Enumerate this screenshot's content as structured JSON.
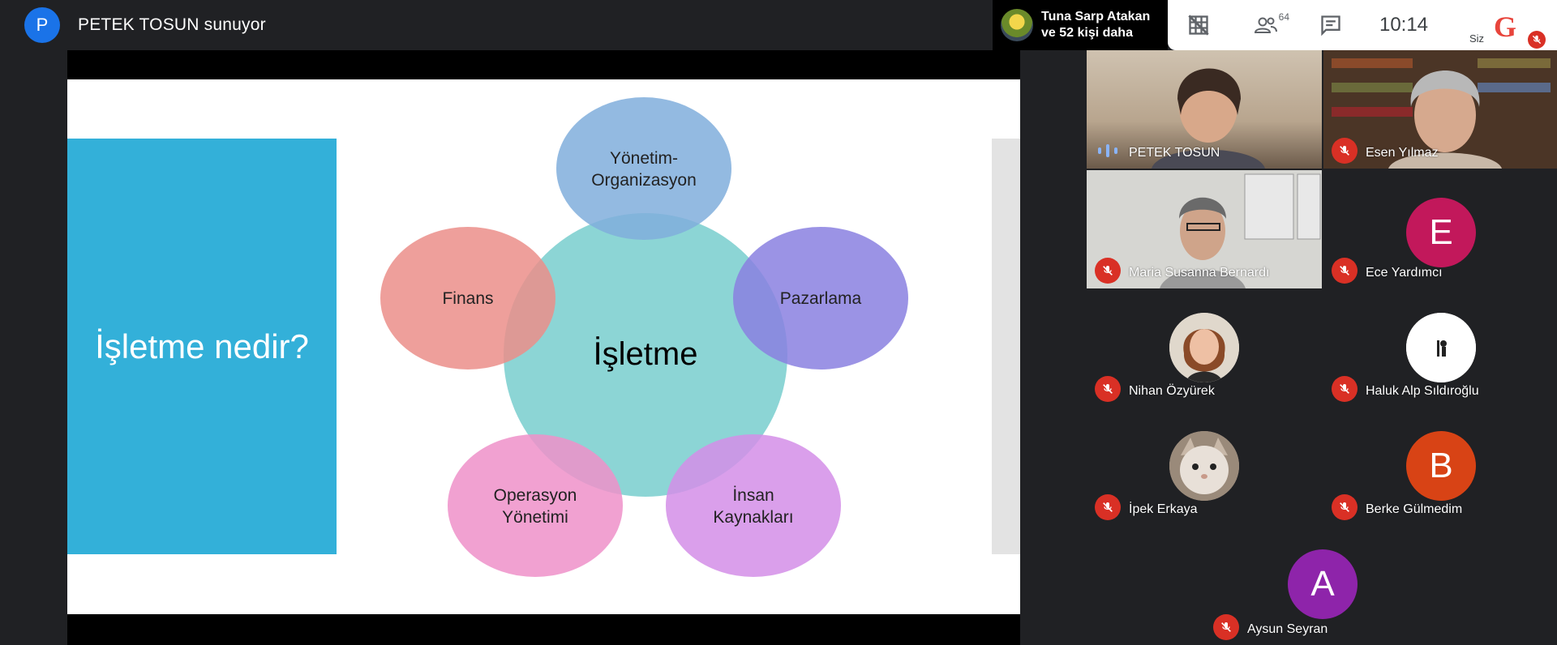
{
  "presenter": {
    "avatar_letter": "P",
    "title": "PETEK TOSUN sunuyor"
  },
  "slide": {
    "heading": "İşletme nedir?",
    "center": "İşletme",
    "nodes": {
      "top_line1": "Yönetim-",
      "top_line2": "Organizasyon",
      "left": "Finans",
      "right": "Pazarlama",
      "bottom_left_line1": "Operasyon",
      "bottom_left_line2": "Yönetimi",
      "bottom_right_line1": "İnsan",
      "bottom_right_line2": "Kaynakları"
    },
    "colors": {
      "side_panel": "#33b0d9",
      "center": "#7fd0d0",
      "top": "#80aedc",
      "left": "#eb8e89",
      "right": "#8a80e0",
      "bottom_left": "#ee90c9",
      "bottom_right": "#d38ee8"
    }
  },
  "pinned": {
    "line1": "Tuna Sarp Atakan",
    "line2": "ve 52 kişi daha"
  },
  "toolbar": {
    "participant_count": "64",
    "time": "10:14",
    "you_label": "Siz",
    "logo_letter": "G"
  },
  "participants": [
    {
      "name": "PETEK TOSUN",
      "speaking": true
    },
    {
      "name": "Esen Yılmaz",
      "muted": true
    },
    {
      "name": "Maria Susanna Bernardı",
      "muted": true
    },
    {
      "name": "Ece Yardımcı",
      "muted": true,
      "letter": "E",
      "color": "#c2185b"
    },
    {
      "name": "Nihan Özyürek",
      "muted": true
    },
    {
      "name": "Haluk Alp Sıldıroğlu",
      "muted": true
    },
    {
      "name": "İpek Erkaya",
      "muted": true
    },
    {
      "name": "Berke Gülmedim",
      "muted": true,
      "letter": "B",
      "color": "#d84315"
    },
    {
      "name": "Aysun Seyran",
      "muted": true,
      "letter": "A",
      "color": "#8e24aa"
    }
  ]
}
